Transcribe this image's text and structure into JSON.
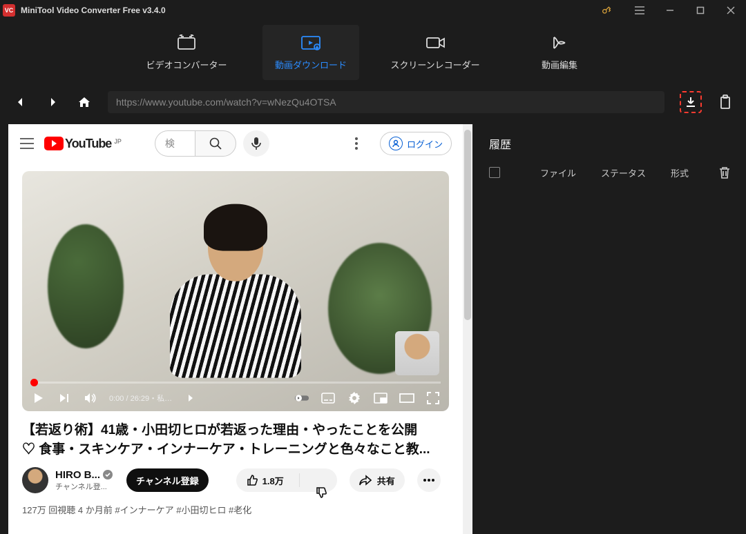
{
  "titlebar": {
    "title": "MiniTool Video Converter Free v3.4.0"
  },
  "tabs": {
    "converter": "ビデオコンバーター",
    "download": "動画ダウンロード",
    "recorder": "スクリーンレコーダー",
    "editor": "動画編集"
  },
  "nav": {
    "url": "https://www.youtube.com/watch?v=wNezQu4OTSA"
  },
  "history": {
    "title": "履歴",
    "col_file": "ファイル",
    "col_status": "ステータス",
    "col_format": "形式"
  },
  "youtube": {
    "brand": "YouTube",
    "country": "JP",
    "search_placeholder": "検",
    "login": "ログイン"
  },
  "player": {
    "time": "0:00 / 26:29・私…"
  },
  "video": {
    "title_line1": "【若返り術】41歳・小田切ヒロが若返った理由・やったことを公開",
    "title_line2": "♡ 食事・スキンケア・インナーケア・トレーニングと色々なこと教...",
    "channel_name": "HIRO B...",
    "channel_sub": "チャンネル登...",
    "subscribe": "チャンネル登録",
    "likes": "1.8万",
    "share": "共有",
    "meta": "127万 回視聴  4 か月前  #インナーケア #小田切ヒロ #老化"
  }
}
